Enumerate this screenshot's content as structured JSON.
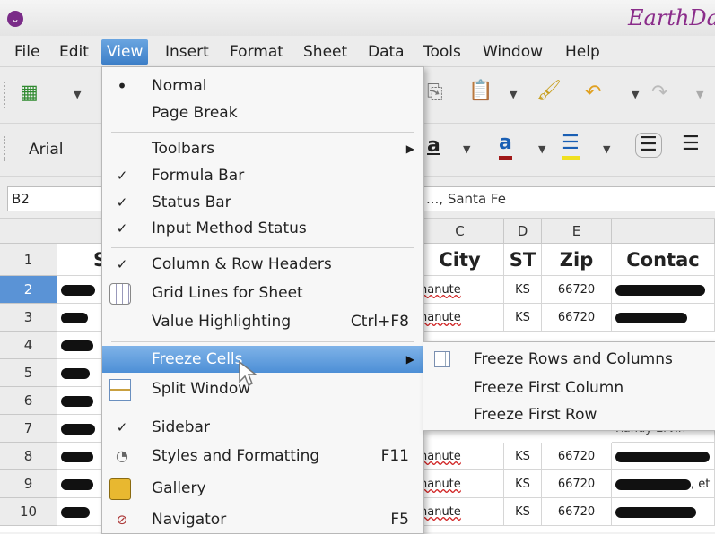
{
  "window": {
    "title": "EarthDa"
  },
  "menubar": {
    "items": [
      {
        "label": "File"
      },
      {
        "label": "Edit"
      },
      {
        "label": "View"
      },
      {
        "label": "Insert"
      },
      {
        "label": "Format"
      },
      {
        "label": "Sheet"
      },
      {
        "label": "Data"
      },
      {
        "label": "Tools"
      },
      {
        "label": "Window"
      },
      {
        "label": "Help"
      }
    ]
  },
  "toolbar": {
    "font_name": "Arial"
  },
  "formula_bar": {
    "cell_ref": "B2",
    "content": "..., Santa Fe"
  },
  "grid": {
    "columns": [
      "C",
      "D",
      "E",
      ""
    ],
    "rows": [
      {
        "num": "1",
        "col_s": "S",
        "city": "City",
        "st": "ST",
        "zip": "Zip",
        "contact": "Contac"
      },
      {
        "num": "2",
        "city": "hanute",
        "st": "KS",
        "zip": "66720"
      },
      {
        "num": "3",
        "city": "hanute",
        "st": "KS",
        "zip": "66720"
      },
      {
        "num": "4"
      },
      {
        "num": "5"
      },
      {
        "num": "6"
      },
      {
        "num": "7",
        "contact": "Randy Ervin"
      },
      {
        "num": "8",
        "city": "hanute",
        "st": "KS",
        "zip": "66720"
      },
      {
        "num": "9",
        "city": "hanute",
        "st": "KS",
        "zip": "66720",
        "contact_tail": ", et"
      },
      {
        "num": "10",
        "city": "hanute",
        "st": "KS",
        "zip": "66720"
      }
    ]
  },
  "view_menu": {
    "items": {
      "normal": "Normal",
      "page_break": "Page Break",
      "toolbars": "Toolbars",
      "formula_bar": "Formula Bar",
      "status_bar": "Status Bar",
      "input_method": "Input Method Status",
      "col_row_headers": "Column & Row Headers",
      "grid_lines": "Grid Lines for Sheet",
      "value_highlighting": "Value Highlighting",
      "value_highlighting_shortcut": "Ctrl+F8",
      "freeze_cells": "Freeze Cells",
      "split_window": "Split Window",
      "sidebar": "Sidebar",
      "styles": "Styles and Formatting",
      "styles_shortcut": "F11",
      "gallery": "Gallery",
      "navigator": "Navigator",
      "navigator_shortcut": "F5"
    }
  },
  "freeze_submenu": {
    "rows_and_columns": "Freeze Rows and Columns",
    "first_column": "Freeze First Column",
    "first_row": "Freeze First Row"
  },
  "colors": {
    "highlight": "#4d8fd6",
    "selected_row": "#5a93d6",
    "brand": "#8a2c8a"
  }
}
